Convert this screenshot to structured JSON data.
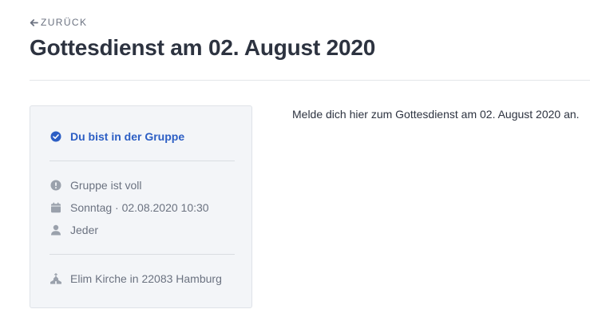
{
  "nav": {
    "back_label": "ZURÜCK"
  },
  "header": {
    "title": "Gottesdienst am 02. August 2020"
  },
  "info_card": {
    "membership_status": "Du bist in der Gruppe",
    "capacity_status": "Gruppe ist voll",
    "date_time": "Sonntag · 02.08.2020 10:30",
    "audience": "Jeder",
    "location": "Elim Kirche in 22083 Hamburg"
  },
  "main": {
    "description": "Melde dich hier zum Gottesdienst am 02. August 2020 an."
  },
  "colors": {
    "accent": "#2c5ec4",
    "muted_text": "#6b7280",
    "title_text": "#2d3340",
    "card_background": "#f3f5f8"
  },
  "icons": {
    "back": "arrow-left-icon",
    "membership": "check-circle-icon",
    "capacity": "exclamation-circle-icon",
    "date": "calendar-icon",
    "audience": "user-icon",
    "location": "church-icon"
  }
}
